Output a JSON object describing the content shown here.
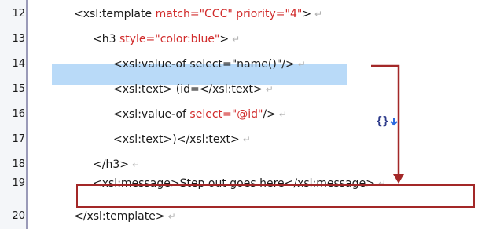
{
  "editor": {
    "lines": [
      {
        "num": "12",
        "parts": [
          "<",
          "xsl:template",
          " ",
          "match=",
          "\"CCC\"",
          " ",
          "priority=",
          "\"4\"",
          ">"
        ]
      },
      {
        "num": "13"
      },
      {
        "num": "14"
      },
      {
        "num": "15"
      },
      {
        "num": "16"
      },
      {
        "num": "17"
      },
      {
        "num": "18"
      },
      {
        "num": "19"
      },
      {
        "num": "20"
      }
    ],
    "l12": {
      "open": "<xsl:template ",
      "a1": "match=",
      "v1": "\"CCC\"",
      "a2": " priority=",
      "v2": "\"4\"",
      "close": ">"
    },
    "l13": {
      "open": "<h3 ",
      "a1": "style=",
      "v1": "\"color:blue\"",
      "close": ">"
    },
    "l14": {
      "text": "<xsl:value-of select=\"name()\"/>"
    },
    "l15": {
      "text": "<xsl:text> (id=</xsl:text>"
    },
    "l16": {
      "open": "<xsl:value-of ",
      "a1": "select=",
      "v1": "\"@id\"",
      "close": "/>"
    },
    "l17": {
      "text": "<xsl:text>)</xsl:text>"
    },
    "l18": {
      "text": "</h3>"
    },
    "l19": {
      "text": "<xsl:message>Step out goes here</xsl:message>"
    },
    "l20": {
      "text": "</xsl:template>"
    },
    "newline_glyph": "↵",
    "step_out_glyph": "{}"
  },
  "colors": {
    "selection": "#b9daf8",
    "arrow": "#a32828",
    "attribute": "#d12b2b",
    "gutter_border": "#9a9ab8"
  }
}
